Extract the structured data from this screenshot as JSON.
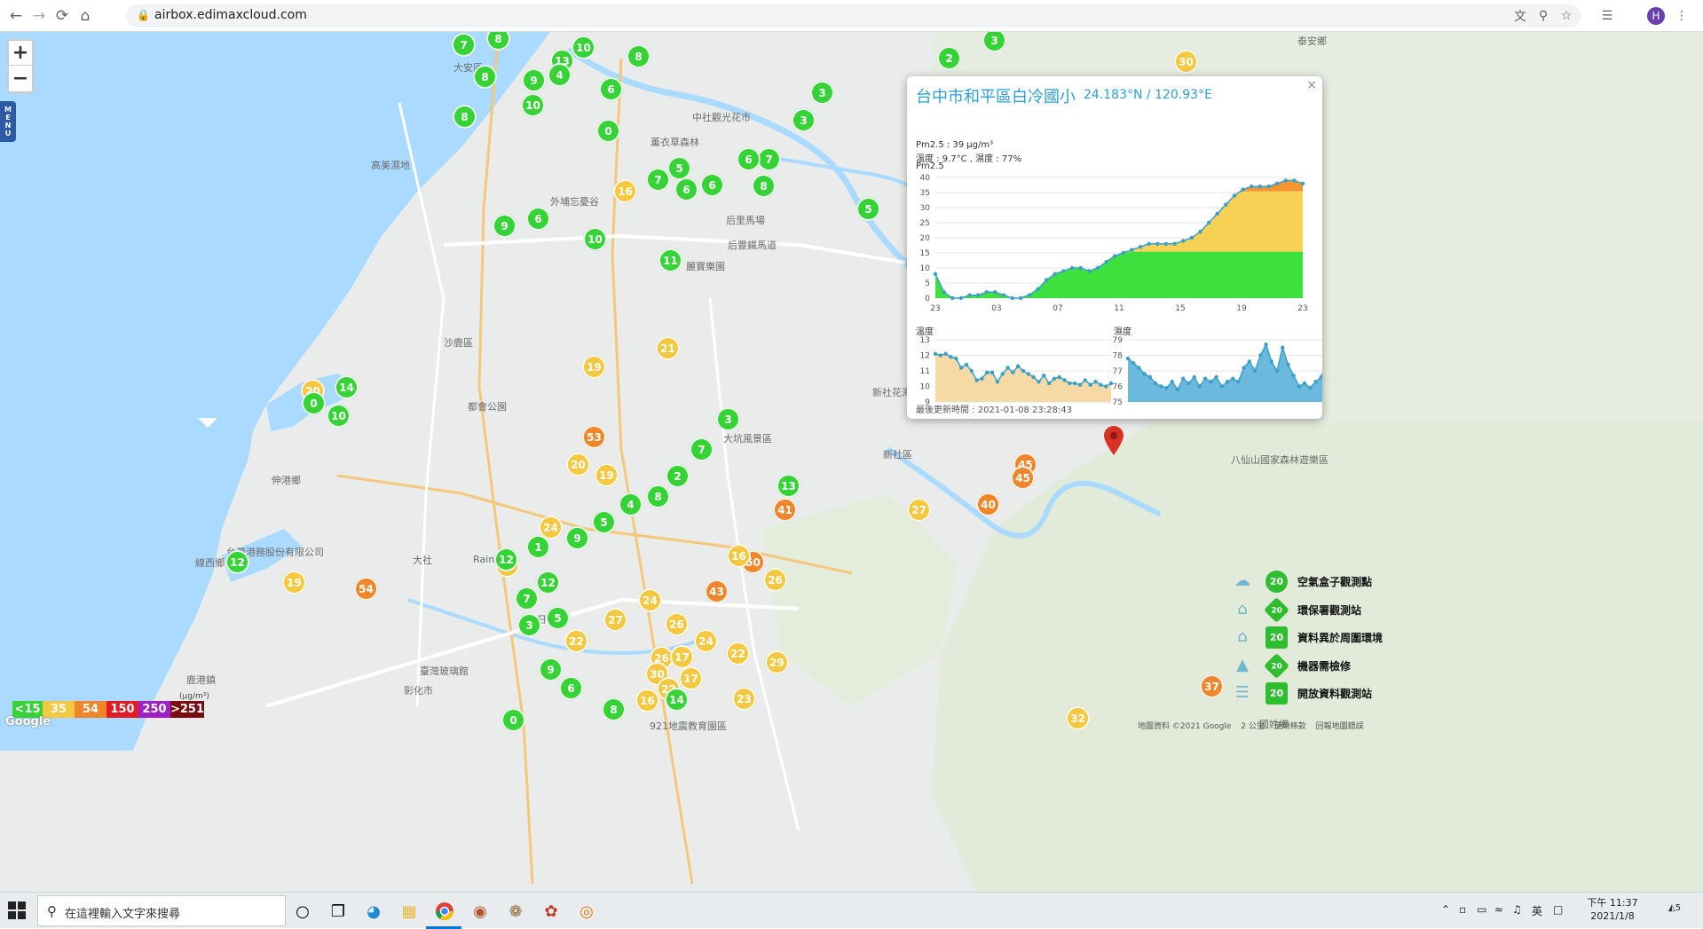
{
  "browser": {
    "url": "airbox.edimaxcloud.com",
    "profile_initial": "H"
  },
  "map": {
    "menu_label": "MENU",
    "places": [
      {
        "name": "大安區"
      },
      {
        "name": "中社觀光花市"
      },
      {
        "name": "薰衣草森林"
      },
      {
        "name": "高美濕地"
      },
      {
        "name": "外埔忘憂谷"
      },
      {
        "name": "后里馬場"
      },
      {
        "name": "后豐鐵馬道"
      },
      {
        "name": "麗寶樂園"
      },
      {
        "name": "沙鹿區"
      },
      {
        "name": "都會公園"
      },
      {
        "name": "大坑風景區"
      },
      {
        "name": "新社花海"
      },
      {
        "name": "新社區"
      },
      {
        "name": "伸港鄉"
      },
      {
        "name": "台灣港務股份有限公司"
      },
      {
        "name": "線西鄉"
      },
      {
        "name": "烏日區"
      },
      {
        "name": "臺灣玻璃館"
      },
      {
        "name": "鹿港鎮"
      },
      {
        "name": "彰化市"
      },
      {
        "name": "八仙山國家森林遊樂區"
      },
      {
        "name": "泰安鄉"
      },
      {
        "name": "國姓鄉"
      },
      {
        "name": "921地震教育園區"
      },
      {
        "name": "大社"
      },
      {
        "name": "Rainbow"
      }
    ],
    "markers": [
      {
        "v": "7",
        "c": "#35d335"
      },
      {
        "v": "8",
        "c": "#35d335"
      },
      {
        "v": "10",
        "c": "#35d335"
      },
      {
        "v": "8",
        "c": "#35d335"
      },
      {
        "v": "13",
        "c": "#35d335"
      },
      {
        "v": "4",
        "c": "#35d335"
      },
      {
        "v": "9",
        "c": "#35d335"
      },
      {
        "v": "8",
        "c": "#35d335"
      },
      {
        "v": "6",
        "c": "#35d335"
      },
      {
        "v": "10",
        "c": "#35d335"
      },
      {
        "v": "8",
        "c": "#35d335"
      },
      {
        "v": "0",
        "c": "#35d335"
      },
      {
        "v": "3",
        "c": "#35d335"
      },
      {
        "v": "2",
        "c": "#35d335"
      },
      {
        "v": "30",
        "c": "#f5c842"
      },
      {
        "v": "3",
        "c": "#35d335"
      },
      {
        "v": "3",
        "c": "#35d335"
      },
      {
        "v": "7",
        "c": "#35d335"
      },
      {
        "v": "6",
        "c": "#35d335"
      },
      {
        "v": "16",
        "c": "#f5c842"
      },
      {
        "v": "5",
        "c": "#35d335"
      },
      {
        "v": "7",
        "c": "#35d335"
      },
      {
        "v": "6",
        "c": "#35d335"
      },
      {
        "v": "8",
        "c": "#35d335"
      },
      {
        "v": "6",
        "c": "#35d335"
      },
      {
        "v": "5",
        "c": "#35d335"
      },
      {
        "v": "11",
        "c": "#35d335"
      },
      {
        "v": "9",
        "c": "#35d335"
      },
      {
        "v": "6",
        "c": "#35d335"
      },
      {
        "v": "10",
        "c": "#35d335"
      },
      {
        "v": "20",
        "c": "#f5c842"
      },
      {
        "v": "0",
        "c": "#35d335"
      },
      {
        "v": "14",
        "c": "#35d335"
      },
      {
        "v": "10",
        "c": "#35d335"
      },
      {
        "v": "21",
        "c": "#f5c842"
      },
      {
        "v": "19",
        "c": "#f5c842"
      },
      {
        "v": "53",
        "c": "#f0862a"
      },
      {
        "v": "20",
        "c": "#f5c842"
      },
      {
        "v": "19",
        "c": "#f5c842"
      },
      {
        "v": "41",
        "c": "#f0862a"
      },
      {
        "v": "45",
        "c": "#f0862a"
      },
      {
        "v": "45",
        "c": "#f0862a"
      },
      {
        "v": "40",
        "c": "#f0862a"
      },
      {
        "v": "27",
        "c": "#f5c842"
      },
      {
        "v": "13",
        "c": "#35d335"
      },
      {
        "v": "24",
        "c": "#f5c842"
      },
      {
        "v": "22",
        "c": "#f5c842"
      },
      {
        "v": "50",
        "c": "#f0862a"
      },
      {
        "v": "43",
        "c": "#f0862a"
      },
      {
        "v": "26",
        "c": "#f5c842"
      },
      {
        "v": "16",
        "c": "#f5c842"
      },
      {
        "v": "19",
        "c": "#f5c842"
      },
      {
        "v": "54",
        "c": "#f0862a"
      },
      {
        "v": "12",
        "c": "#35d335"
      },
      {
        "v": "22",
        "c": "#f5c842"
      },
      {
        "v": "27",
        "c": "#f5c842"
      },
      {
        "v": "24",
        "c": "#f5c842"
      },
      {
        "v": "26",
        "c": "#f5c842"
      },
      {
        "v": "24",
        "c": "#f5c842"
      },
      {
        "v": "22",
        "c": "#f5c842"
      },
      {
        "v": "29",
        "c": "#f5c842"
      },
      {
        "v": "26",
        "c": "#f5c842"
      },
      {
        "v": "17",
        "c": "#f5c842"
      },
      {
        "v": "30",
        "c": "#f5c842"
      },
      {
        "v": "22",
        "c": "#f5c842"
      },
      {
        "v": "17",
        "c": "#f5c842"
      },
      {
        "v": "23",
        "c": "#f5c842"
      },
      {
        "v": "16",
        "c": "#f5c842"
      },
      {
        "v": "37",
        "c": "#f0862a"
      },
      {
        "v": "32",
        "c": "#f5c842"
      },
      {
        "v": "14",
        "c": "#35d335"
      },
      {
        "v": "0",
        "c": "#35d335"
      },
      {
        "v": "8",
        "c": "#35d335"
      },
      {
        "v": "6",
        "c": "#35d335"
      },
      {
        "v": "9",
        "c": "#35d335"
      },
      {
        "v": "3",
        "c": "#35d335"
      },
      {
        "v": "5",
        "c": "#35d335"
      },
      {
        "v": "7",
        "c": "#35d335"
      },
      {
        "v": "12",
        "c": "#35d335"
      },
      {
        "v": "12",
        "c": "#35d335"
      },
      {
        "v": "1",
        "c": "#35d335"
      },
      {
        "v": "9",
        "c": "#35d335"
      },
      {
        "v": "5",
        "c": "#35d335"
      },
      {
        "v": "4",
        "c": "#35d335"
      },
      {
        "v": "8",
        "c": "#35d335"
      },
      {
        "v": "2",
        "c": "#35d335"
      },
      {
        "v": "7",
        "c": "#35d335"
      },
      {
        "v": "3",
        "c": "#35d335"
      }
    ]
  },
  "popup": {
    "close": "×",
    "title": "台中市和平區白冷國小",
    "coords": "24.183°N / 120.93°E",
    "pm25_line": "Pm2.5 : 39 μg/m³",
    "temp_humidity_line": "溫度 : 9.7°C , 濕度 : 77%",
    "pm25_chart_label": "Pm2.5",
    "temp_chart_label": "溫度",
    "humidity_chart_label": "濕度",
    "updated": "最後更新時間 : 2021-01-08 23:28:43"
  },
  "chart_data": [
    {
      "type": "area",
      "ylabel": "Pm2.5",
      "x_ticks": [
        "23",
        "03",
        "07",
        "11",
        "15",
        "19",
        "23"
      ],
      "y_ticks": [
        0,
        5,
        10,
        15,
        20,
        25,
        30,
        35,
        40
      ],
      "ylim": [
        0,
        40
      ],
      "values": [
        8,
        2,
        0,
        0,
        1,
        1,
        2,
        2,
        1,
        0,
        0,
        1,
        3,
        6,
        8,
        9,
        10,
        10,
        9,
        10,
        12,
        14,
        15,
        16,
        17,
        18,
        18,
        18,
        18,
        19,
        20,
        22,
        25,
        28,
        31,
        34,
        36,
        37,
        37,
        37,
        38,
        39,
        39,
        38
      ]
    },
    {
      "type": "area",
      "ylabel": "溫度",
      "y_ticks": [
        9,
        10,
        11,
        12,
        13
      ],
      "ylim": [
        9,
        13
      ],
      "values": [
        12.1,
        12.0,
        12.1,
        11.9,
        11.8,
        11.2,
        11.4,
        11.0,
        10.4,
        10.5,
        10.9,
        10.9,
        10.3,
        10.8,
        11.2,
        10.9,
        11.3,
        11.0,
        10.8,
        10.6,
        10.3,
        10.7,
        10.2,
        10.5,
        10.6,
        10.4,
        10.2,
        10.2,
        10.1,
        10.4,
        10.1,
        10.3,
        10.1,
        10.0,
        10.2
      ]
    },
    {
      "type": "area",
      "ylabel": "濕度",
      "y_ticks": [
        75,
        76,
        77,
        78,
        79
      ],
      "ylim": [
        75,
        79
      ],
      "values": [
        77.8,
        77.5,
        77.2,
        76.8,
        76.6,
        76.2,
        76.0,
        75.9,
        76.3,
        75.8,
        76.5,
        76.2,
        76.6,
        76.0,
        76.5,
        76.3,
        76.6,
        76.0,
        76.3,
        76.5,
        76.3,
        77.2,
        77.6,
        77.0,
        78.0,
        78.7,
        77.6,
        77.0,
        78.5,
        77.4,
        76.7,
        76.0,
        76.2,
        75.9,
        76.3,
        76.6,
        77.6
      ]
    }
  ],
  "aqi_legend": [
    {
      "label": "<15",
      "color": "#35d335"
    },
    {
      "label": "35",
      "color": "#f5c842"
    },
    {
      "label": "54",
      "color": "#f0862a"
    },
    {
      "label": "150",
      "color": "#e51b23"
    },
    {
      "label": "250",
      "color": "#a020c8"
    },
    {
      "label": ">251",
      "color": "#7a0d10"
    }
  ],
  "aqi_unit": "(μg/m³)",
  "station_legend": [
    {
      "label": "空氣盒子觀測點",
      "badge": "20",
      "icon": "cloud-icon"
    },
    {
      "label": "環保署觀測站",
      "badge": "20",
      "icon": "building-icon"
    },
    {
      "label": "資料異於周圍環境",
      "badge": "20",
      "icon": "house-icon"
    },
    {
      "label": "機器需檢修",
      "badge": "20",
      "icon": "cone-icon"
    },
    {
      "label": "開放資料觀測站",
      "badge": "20",
      "icon": "stack-icon"
    }
  ],
  "attribution": {
    "google": "Google",
    "data": "地圖資料 ©2021 Google",
    "scale": "2 公里",
    "terms": "使用條款",
    "report": "回報地圖錯誤"
  },
  "taskbar": {
    "search_placeholder": "在這裡輸入文字來搜尋",
    "ime": "英",
    "time": "下午 11:37",
    "date": "2021/1/8",
    "notification_count": "5"
  }
}
